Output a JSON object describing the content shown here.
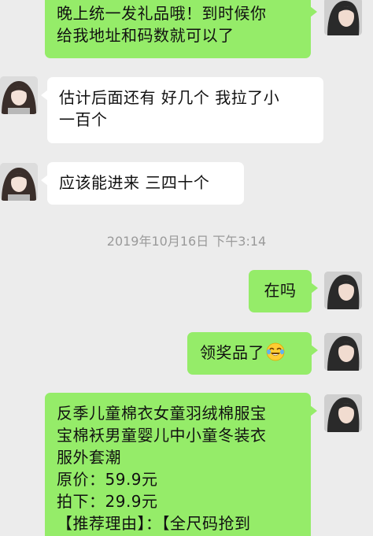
{
  "messages": [
    {
      "side": "out",
      "lines": [
        "晚上统一发礼品哦！到时候你",
        "给我地址和码数就可以了"
      ]
    },
    {
      "side": "in",
      "lines": [
        "估计后面还有 好几个 我拉了小",
        "一百个"
      ]
    },
    {
      "side": "in",
      "lines": [
        "应该能进来 三四十个"
      ]
    },
    {
      "side": "out",
      "lines": [
        "在吗"
      ]
    },
    {
      "side": "out",
      "text": "领奖品了",
      "emoji": "tears-of-joy-emoji-icon"
    },
    {
      "side": "out",
      "lines": [
        "反季儿童棉衣女童羽绒棉服宝",
        "宝棉袄男童婴儿中小童冬装衣",
        "服外套潮",
        "原价：59.9元",
        "拍下：29.9元",
        "【推荐理由】：【全尺码抢到"
      ]
    }
  ],
  "timestamp": "2019年10月16日 下午3:14",
  "colors": {
    "background": "#ececec",
    "bubble_out": "#95ec69",
    "bubble_in": "#ffffff",
    "timestamp_text": "#9a9a9a"
  }
}
